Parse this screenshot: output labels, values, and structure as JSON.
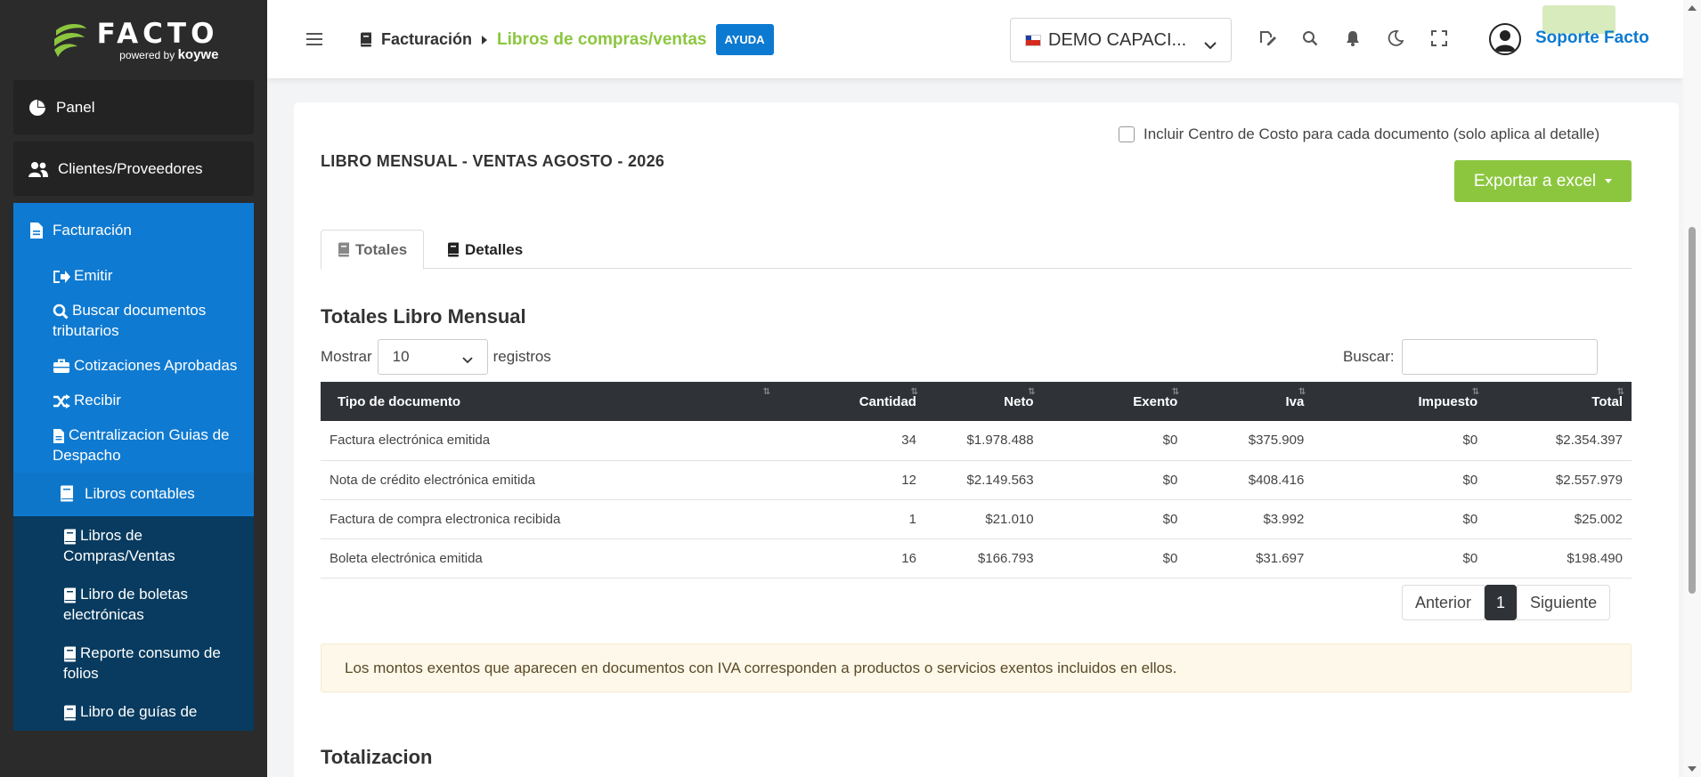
{
  "sidebar": {
    "logo_word": "FACTO",
    "logo_powered": "powered",
    "logo_by": "by",
    "logo_brand": "koywe",
    "panel": "Panel",
    "clientes": "Clientes/Proveedores",
    "facturacion": "Facturación",
    "sub_items": [
      "Emitir",
      "Buscar documentos tributarios",
      "Cotizaciones Aprobadas",
      "Recibir",
      "Centralizacion Guias de Despacho"
    ],
    "libros_contables": "Libros contables",
    "libros_items": [
      "Libros de Compras/Ventas",
      "Libro de boletas electrónicas",
      "Reporte consumo de folios",
      "Libro de guías de"
    ]
  },
  "header": {
    "crumb_section": "Facturación",
    "crumb_page": "Libros de compras/ventas",
    "ayuda": "AYUDA",
    "company": "DEMO CAPACI...",
    "user": "Soporte Facto"
  },
  "content": {
    "cost_center_label": "Incluir Centro de Costo para cada documento (solo aplica al detalle)",
    "title": "LIBRO MENSUAL - VENTAS AGOSTO - 2026",
    "export_label": "Exportar a excel",
    "tabs": [
      "Totales",
      "Detalles"
    ],
    "section_title": "Totales Libro Mensual",
    "show_label": "Mostrar",
    "show_value": "10",
    "records_label": "registros",
    "search_label": "Buscar:",
    "table": {
      "headers": [
        "Tipo de documento",
        "Cantidad",
        "Neto",
        "Exento",
        "Iva",
        "Impuesto",
        "Total"
      ],
      "rows": [
        [
          "Factura electrónica emitida",
          "34",
          "$1.978.488",
          "$0",
          "$375.909",
          "$0",
          "$2.354.397"
        ],
        [
          "Nota de crédito electrónica emitida",
          "12",
          "$2.149.563",
          "$0",
          "$408.416",
          "$0",
          "$2.557.979"
        ],
        [
          "Factura de compra electronica recibida",
          "1",
          "$21.010",
          "$0",
          "$3.992",
          "$0",
          "$25.002"
        ],
        [
          "Boleta electrónica emitida",
          "16",
          "$166.793",
          "$0",
          "$31.697",
          "$0",
          "$198.490"
        ]
      ]
    },
    "pager": {
      "prev": "Anterior",
      "current": "1",
      "next": "Siguiente"
    },
    "alert": "Los montos exentos que aparecen en documentos con IVA corresponden a productos o servicios exentos incluidos en ellos.",
    "section2_title": "Totalizacion"
  },
  "colors": {
    "accent_green": "#8cc63f",
    "accent_blue": "#0c7ad1",
    "dark": "#2f3338"
  }
}
